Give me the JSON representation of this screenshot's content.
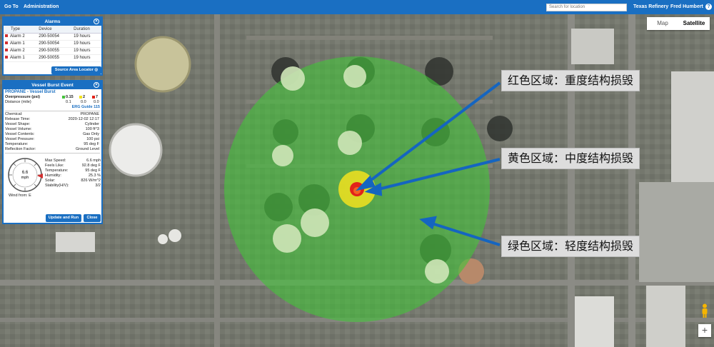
{
  "topbar": {
    "goto": "Go To",
    "administration": "Administration",
    "search_placeholder": "Search for location",
    "site": "Texas Refinery",
    "user": "Fred Humbert",
    "help": "?"
  },
  "map_toggle": {
    "map": "Map",
    "satellite": "Satellite",
    "active": "Satellite"
  },
  "alarms": {
    "title": "Alarms",
    "columns": [
      "Type",
      "Device",
      "Duration"
    ],
    "rows": [
      {
        "type": "Alarm 2",
        "device": "290-50054",
        "duration": "19 hours"
      },
      {
        "type": "Alarm 1",
        "device": "290-50054",
        "duration": "19 hours"
      },
      {
        "type": "Alarm 2",
        "device": "290-50055",
        "duration": "19 hours"
      },
      {
        "type": "Alarm 1",
        "device": "290-50055",
        "duration": "19 hours"
      }
    ],
    "locator_button": "Source Area Locator"
  },
  "vessel": {
    "title": "Vessel Burst Event",
    "subtitle": "PROPANE - Vessel Burst",
    "overpressure_label": "Overpressure (psi)",
    "thresholds": [
      "0.15",
      "2",
      "7"
    ],
    "distance_label": "Distance (mile)",
    "distances": [
      "0.1",
      "0.0",
      "0.0"
    ],
    "erg": "ERG Guide 115",
    "fields": [
      {
        "label": "Chemical:",
        "value": "PROPANE"
      },
      {
        "label": "Release Time:",
        "value": "2020-12-02 12:17"
      },
      {
        "label": "Vessel Shape:",
        "value": "Cylinder"
      },
      {
        "label": "Vessel Volume:",
        "value": "100 ft^3"
      },
      {
        "label": "Vessel Contents:",
        "value": "Gas Only"
      },
      {
        "label": "Vessel Pressure:",
        "value": "100 psi"
      },
      {
        "label": "Temperature:",
        "value": "95 deg F"
      },
      {
        "label": "Reflection Factor:",
        "value": "Ground Level"
      }
    ],
    "weather": [
      {
        "label": "Max Speed:",
        "value": "6.6 mph"
      },
      {
        "label": "Feels Like:",
        "value": "92.8 deg F"
      },
      {
        "label": "Temperature:",
        "value": "95 deg F"
      },
      {
        "label": "Humidity:",
        "value": "25.3 %"
      },
      {
        "label": "Solar:",
        "value": "826 W/m^2"
      },
      {
        "label": "Stability(H/V):",
        "value": "3/2"
      }
    ],
    "wind_speed": "6.6",
    "wind_unit": "mph",
    "wind_from": "Wind from: E",
    "update_button": "Update and Run",
    "close_button": "Close"
  },
  "callouts": {
    "red": "红色区域：重度结构损毁",
    "yellow": "黄色区域：中度结构损毁",
    "green": "绿色区域：轻度结构损毁"
  },
  "colors": {
    "brand": "#1a6fc2",
    "zone_green": "#44c23a",
    "zone_yellow": "#f2e21e",
    "zone_red": "#e2231a",
    "arrow": "#1565c0"
  },
  "icons": {
    "help": "question-circle-icon",
    "locator": "target-icon",
    "close": "close-icon",
    "pegman": "street-view-icon",
    "zoom_in": "plus-icon"
  },
  "zoom_in": "+"
}
